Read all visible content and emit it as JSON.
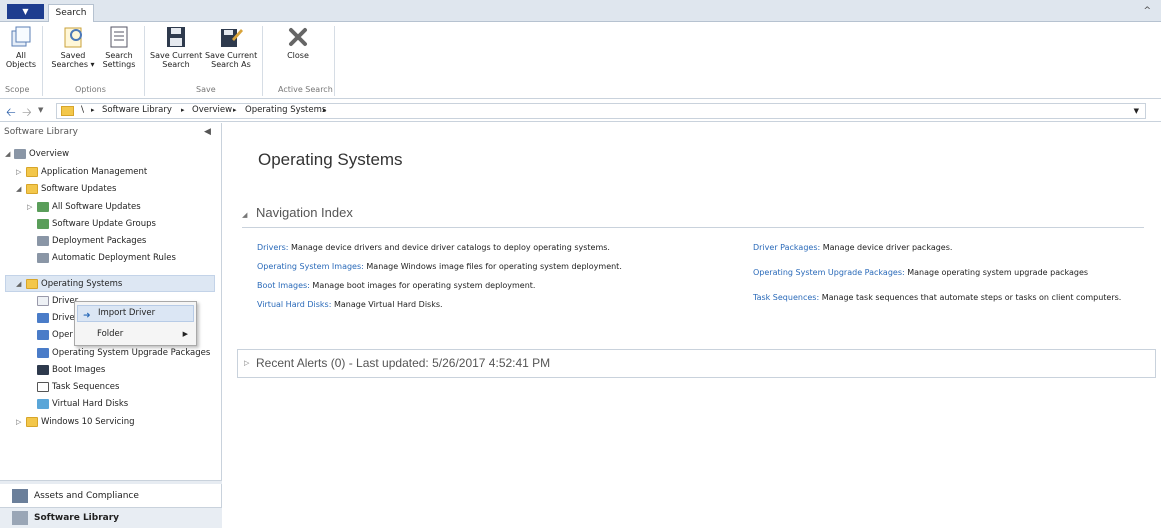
{
  "ribbon": {
    "tab": "Search",
    "buttons": {
      "all_objects": "All\nObjects",
      "saved_searches": "Saved\nSearches ▾",
      "search_settings": "Search\nSettings",
      "save_current_search": "Save Current\nSearch",
      "save_current_search_as": "Save Current\nSearch As",
      "close": "Close"
    },
    "groups": {
      "scope": "Scope",
      "options": "Options",
      "save": "Save",
      "active_search": "Active Search"
    }
  },
  "address": {
    "root_sep": "\\",
    "crumbs": [
      "Software Library",
      "Overview",
      "Operating Systems"
    ]
  },
  "left": {
    "header": "Software Library",
    "tree": {
      "overview": "Overview",
      "application_management": "Application Management",
      "software_updates": "Software Updates",
      "all_software_updates": "All Software Updates",
      "software_update_groups": "Software Update Groups",
      "deployment_packages": "Deployment Packages",
      "automatic_deployment_rules": "Automatic Deployment Rules",
      "operating_systems": "Operating Systems",
      "drivers_partial": "Driver",
      "driver_packages_partial": "Driver",
      "os_images_partial": "Oper",
      "os_upgrade_packages": "Operating System Upgrade Packages",
      "boot_images": "Boot Images",
      "task_sequences": "Task Sequences",
      "virtual_hard_disks": "Virtual Hard Disks",
      "windows10_servicing": "Windows 10 Servicing"
    },
    "context_menu": {
      "import_driver": "Import Driver",
      "folder": "Folder"
    },
    "workspaces": {
      "assets": "Assets and Compliance",
      "software": "Software Library"
    }
  },
  "main": {
    "title": "Operating Systems",
    "nav_index_title": "Navigation Index",
    "nav_index": {
      "drivers_link": "Drivers:",
      "drivers_text": "Manage device drivers and device driver catalogs to deploy operating systems.",
      "os_images_link": "Operating System Images:",
      "os_images_text": "Manage Windows image files for operating system deployment.",
      "boot_images_link": "Boot Images:",
      "boot_images_text": "Manage boot images for operating system deployment.",
      "vhd_link": "Virtual Hard Disks:",
      "vhd_text": "Manage Virtual Hard Disks.",
      "driver_packages_link": "Driver Packages:",
      "driver_packages_text": "Manage device driver packages.",
      "os_upgrade_link": "Operating System Upgrade Packages:",
      "os_upgrade_text": "Manage operating system upgrade packages",
      "task_sequences_link": "Task Sequences:",
      "task_sequences_text": "Manage task sequences that automate steps or tasks on client computers."
    },
    "recent_alerts": "Recent Alerts (0) - Last updated: 5/26/2017 4:52:41 PM"
  }
}
